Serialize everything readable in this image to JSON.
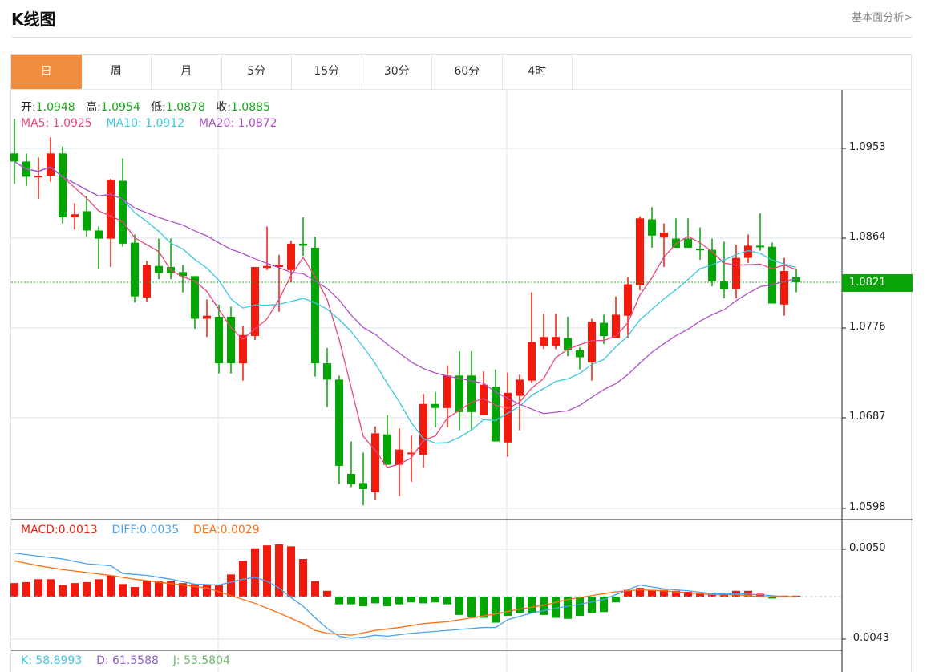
{
  "header": {
    "title": "K线图",
    "more_link": "基本面分析>"
  },
  "tabs": [
    {
      "label": "日",
      "active": true
    },
    {
      "label": "周"
    },
    {
      "label": "月"
    },
    {
      "label": "5分"
    },
    {
      "label": "15分"
    },
    {
      "label": "30分"
    },
    {
      "label": "60分"
    },
    {
      "label": "4时"
    }
  ],
  "ohlc_legend": {
    "open_label": "开:",
    "open": "1.0948",
    "high_label": "高:",
    "high": "1.0954",
    "low_label": "低:",
    "low": "1.0878",
    "close_label": "收:",
    "close": "1.0885"
  },
  "ma_legend": {
    "ma5": "MA5: 1.0925",
    "ma10": "MA10: 1.0912",
    "ma20": "MA20: 1.0872"
  },
  "macd_legend": {
    "macd": "MACD:0.0013",
    "diff": "DIFF:0.0035",
    "dea": "DEA:0.0029"
  },
  "kdj_legend": {
    "k": "K: 58.8993",
    "d": "D: 61.5588",
    "j": "J: 53.5804"
  },
  "colors": {
    "up": "#f21a0c",
    "down": "#02a602",
    "ma5": "#e8467c",
    "ma10": "#3cc8e0",
    "ma20": "#b050c8",
    "diff": "#4aa3f0",
    "dea": "#ff7010",
    "accent": "#f28c3e"
  },
  "chart_data": {
    "type": "candlestick",
    "price_axis": {
      "ticks": [
        "1.0953",
        "1.0864",
        "1.0776",
        "1.0687",
        "1.0598"
      ],
      "current": "1.0821"
    },
    "candles": [
      [
        1.0948,
        1.094,
        1.0982,
        1.0918
      ],
      [
        1.094,
        1.0925,
        1.0948,
        1.0916
      ],
      [
        1.0925,
        1.0926,
        1.0944,
        1.0903
      ],
      [
        1.0926,
        1.0948,
        1.0964,
        1.092
      ],
      [
        1.0948,
        1.0885,
        1.0955,
        1.0879
      ],
      [
        1.0885,
        1.0888,
        1.0899,
        1.0873
      ],
      [
        1.0891,
        1.0872,
        1.0906,
        1.0866
      ],
      [
        1.0872,
        1.0864,
        1.0876,
        1.0834
      ],
      [
        1.0864,
        1.0922,
        1.0923,
        1.0836
      ],
      [
        1.0921,
        1.0859,
        1.0943,
        1.0856
      ],
      [
        1.086,
        1.0807,
        1.0868,
        1.0801
      ],
      [
        1.0806,
        1.0838,
        1.0842,
        1.0802
      ],
      [
        1.0837,
        1.083,
        1.0864,
        1.0824
      ],
      [
        1.0836,
        1.083,
        1.0864,
        1.0824
      ],
      [
        1.0831,
        1.0827,
        1.0838,
        1.0811
      ],
      [
        1.0827,
        1.0785,
        1.0827,
        1.0775
      ],
      [
        1.0785,
        1.0788,
        1.0804,
        1.0767
      ],
      [
        1.0787,
        1.0741,
        1.0799,
        1.0731
      ],
      [
        1.0787,
        1.0741,
        1.0797,
        1.0731
      ],
      [
        1.0741,
        1.0769,
        1.0778,
        1.0724
      ],
      [
        1.0768,
        1.0836,
        1.0836,
        1.0764
      ],
      [
        1.0835,
        1.0837,
        1.0876,
        1.0833
      ],
      [
        1.0836,
        1.0838,
        1.0848,
        1.0792
      ],
      [
        1.0833,
        1.0859,
        1.0862,
        1.0821
      ],
      [
        1.0859,
        1.0857,
        1.0885,
        1.0847
      ],
      [
        1.0855,
        1.0741,
        1.0866,
        1.0728
      ],
      [
        1.0741,
        1.0725,
        1.0756,
        1.0698
      ],
      [
        1.0725,
        1.064,
        1.0729,
        1.0622
      ],
      [
        1.0632,
        1.0622,
        1.0664,
        1.0619
      ],
      [
        1.0623,
        1.0617,
        1.0653,
        1.0601
      ],
      [
        1.0614,
        1.0672,
        1.0679,
        1.0606
      ],
      [
        1.0671,
        1.0641,
        1.069,
        1.0641
      ],
      [
        1.0641,
        1.0656,
        1.0677,
        1.061
      ],
      [
        1.0652,
        1.0653,
        1.067,
        1.0624
      ],
      [
        1.0651,
        1.0701,
        1.0711,
        1.0638
      ],
      [
        1.0701,
        1.0697,
        1.0713,
        1.0678
      ],
      [
        1.0697,
        1.0729,
        1.0739,
        1.0678
      ],
      [
        1.0729,
        1.0693,
        1.0753,
        1.0675
      ],
      [
        1.0729,
        1.0693,
        1.0753,
        1.0675
      ],
      [
        1.069,
        1.072,
        1.0733,
        1.069
      ],
      [
        1.0718,
        1.0664,
        1.0735,
        1.0664
      ],
      [
        1.0663,
        1.0712,
        1.0732,
        1.0649
      ],
      [
        1.0709,
        1.0725,
        1.073,
        1.0675
      ],
      [
        1.0724,
        1.0762,
        1.0811,
        1.0722
      ],
      [
        1.0758,
        1.0767,
        1.079,
        1.0755
      ],
      [
        1.0758,
        1.0767,
        1.079,
        1.0755
      ],
      [
        1.0766,
        1.0754,
        1.0787,
        1.0748
      ],
      [
        1.0754,
        1.0747,
        1.0757,
        1.0735
      ],
      [
        1.0742,
        1.0782,
        1.0785,
        1.0724
      ],
      [
        1.0781,
        1.0768,
        1.0789,
        1.076
      ],
      [
        1.0766,
        1.0789,
        1.0807,
        1.0766
      ],
      [
        1.0788,
        1.0819,
        1.0826,
        1.0766
      ],
      [
        1.0818,
        1.0884,
        1.0886,
        1.0813
      ],
      [
        1.0883,
        1.0867,
        1.0895,
        1.0855
      ],
      [
        1.0865,
        1.087,
        1.0879,
        1.0836
      ],
      [
        1.0864,
        1.0855,
        1.0884,
        1.0855
      ],
      [
        1.0864,
        1.0855,
        1.0884,
        1.0855
      ],
      [
        1.0854,
        1.0853,
        1.0875,
        1.0843
      ],
      [
        1.0853,
        1.0822,
        1.0864,
        1.0817
      ],
      [
        1.0822,
        1.0814,
        1.0861,
        1.0805
      ],
      [
        1.0814,
        1.0845,
        1.0858,
        1.0805
      ],
      [
        1.0845,
        1.0857,
        1.0868,
        1.084
      ],
      [
        1.0857,
        1.0856,
        1.0889,
        1.0852
      ],
      [
        1.0856,
        1.08,
        1.086,
        1.08
      ],
      [
        1.0799,
        1.0832,
        1.0845,
        1.0788
      ],
      [
        1.0826,
        1.0821,
        1.0834,
        1.0811
      ]
    ],
    "macd_axis": {
      "ticks": [
        "0.0050",
        "-0.0043"
      ]
    },
    "macd_hist": [
      0.0014,
      0.0015,
      0.0018,
      0.0018,
      0.0012,
      0.0014,
      0.0015,
      0.0018,
      0.0022,
      0.0013,
      0.001,
      0.0016,
      0.0016,
      0.0016,
      0.0014,
      0.0013,
      0.0012,
      0.0012,
      0.0023,
      0.0037,
      0.005,
      0.0053,
      0.0054,
      0.0052,
      0.0039,
      0.0016,
      0.0006,
      -0.0008,
      -0.0008,
      -0.001,
      -0.0007,
      -0.001,
      -0.0008,
      -0.0006,
      -0.0007,
      -0.0006,
      -0.0008,
      -0.0019,
      -0.0021,
      -0.0022,
      -0.0027,
      -0.002,
      -0.0017,
      -0.0017,
      -0.0019,
      -0.0022,
      -0.0023,
      -0.002,
      -0.0017,
      -0.0016,
      -0.0006,
      0.0007,
      0.0009,
      0.0007,
      0.0007,
      0.0006,
      0.0005,
      0.0004,
      0.0004,
      0.0003,
      0.0006,
      0.0006,
      0.0003,
      -0.0002,
      0.0001,
      0.0001
    ],
    "diff": [
      [
        0,
        0.0045
      ],
      [
        2,
        0.0042
      ],
      [
        4,
        0.0039
      ],
      [
        6,
        0.0034
      ],
      [
        8,
        0.0032
      ],
      [
        9,
        0.0024
      ],
      [
        11,
        0.0022
      ],
      [
        13,
        0.0018
      ],
      [
        15,
        0.0013
      ],
      [
        17,
        0.0012
      ],
      [
        19,
        0.0018
      ],
      [
        20,
        0.002
      ],
      [
        21,
        0.0016
      ],
      [
        22,
        0.0009
      ],
      [
        23,
        -0.0001
      ],
      [
        24,
        -0.001
      ],
      [
        25,
        -0.0022
      ],
      [
        26,
        -0.0033
      ],
      [
        27,
        -0.0041
      ],
      [
        28,
        -0.0043
      ],
      [
        29,
        -0.0042
      ],
      [
        30,
        -0.004
      ],
      [
        31,
        -0.0041
      ],
      [
        33,
        -0.0038
      ],
      [
        35,
        -0.0036
      ],
      [
        37,
        -0.0034
      ],
      [
        39,
        -0.0032
      ],
      [
        40,
        -0.0032
      ],
      [
        41,
        -0.0024
      ],
      [
        43,
        -0.0017
      ],
      [
        45,
        -0.0012
      ],
      [
        47,
        -0.0008
      ],
      [
        49,
        -0.0003
      ],
      [
        51,
        0.0007
      ],
      [
        52,
        0.0012
      ],
      [
        54,
        0.0008
      ],
      [
        56,
        0.0006
      ],
      [
        58,
        0.0003
      ],
      [
        60,
        0.0003
      ],
      [
        62,
        0.0002
      ],
      [
        64,
        0
      ],
      [
        65,
        0
      ]
    ],
    "dea": [
      [
        0,
        0.0037
      ],
      [
        2,
        0.0032
      ],
      [
        4,
        0.0028
      ],
      [
        6,
        0.0025
      ],
      [
        8,
        0.0022
      ],
      [
        10,
        0.0018
      ],
      [
        12,
        0.0015
      ],
      [
        14,
        0.0012
      ],
      [
        16,
        0.0009
      ],
      [
        18,
        0.0001
      ],
      [
        20,
        -0.0007
      ],
      [
        22,
        -0.0017
      ],
      [
        24,
        -0.0028
      ],
      [
        25,
        -0.0035
      ],
      [
        26,
        -0.0038
      ],
      [
        28,
        -0.004
      ],
      [
        30,
        -0.0035
      ],
      [
        32,
        -0.0032
      ],
      [
        34,
        -0.0028
      ],
      [
        36,
        -0.0026
      ],
      [
        38,
        -0.0022
      ],
      [
        40,
        -0.0018
      ],
      [
        42,
        -0.0013
      ],
      [
        44,
        -0.0009
      ],
      [
        46,
        -0.0003
      ],
      [
        48,
        0.0001
      ],
      [
        50,
        0.0005
      ],
      [
        52,
        0.0007
      ],
      [
        54,
        0.0006
      ],
      [
        56,
        0.0004
      ],
      [
        58,
        0.0002
      ],
      [
        60,
        0.0002
      ],
      [
        62,
        0
      ],
      [
        65,
        0
      ]
    ]
  }
}
